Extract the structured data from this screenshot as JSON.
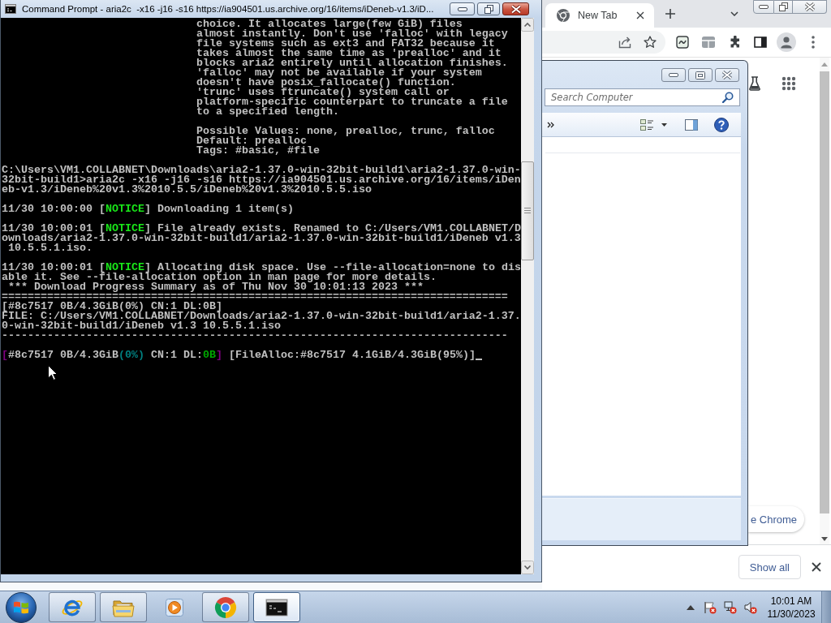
{
  "cmd_window": {
    "title": "Command Prompt - aria2c  -x16 -j16 -s16 https://ia904501.us.archive.org/16/items/iDeneb-v1.3/iD...",
    "console": {
      "blocks": [
        {
          "kind": "help",
          "lines": [
            {
              "text": "choice. It allocates large(few GiB) files"
            },
            {
              "text": "almost instantly. Don't use 'falloc' with legacy"
            },
            {
              "text": "file systems such as ext3 and FAT32 because it"
            },
            {
              "text": "takes almost the same time as 'prealloc' and it"
            },
            {
              "text": "blocks aria2 entirely until allocation finishes."
            },
            {
              "text": "'falloc' may not be available if your system"
            },
            {
              "text": "doesn't have posix_fallocate() function."
            },
            {
              "text": "'trunc' uses ftruncate() system call or"
            },
            {
              "text": "platform-specific counterpart to truncate a file"
            },
            {
              "text": "to a specified length."
            }
          ]
        },
        {
          "kind": "help",
          "lines": [
            {
              "text": "Possible Values: none, prealloc, trunc, falloc"
            },
            {
              "text": "Default: prealloc"
            },
            {
              "text": "Tags: #basic, #file"
            }
          ]
        },
        {
          "kind": "output",
          "lines": [
            {
              "text": "C:\\Users\\VM1.COLLABNET\\Downloads\\aria2-1.37.0-win-32bit-build1\\aria2-1.37.0-win-"
            },
            {
              "text": "32bit-build1>aria2c -x16 -j16 -s16 https://ia904501.us.archive.org/16/items/iDen"
            },
            {
              "text": "eb-v1.3/iDeneb%20v1.3%2010.5.5/iDeneb%20v1.3%2010.5.5.iso"
            }
          ]
        },
        {
          "kind": "output",
          "lines": [
            {
              "parts": [
                {
                  "text": "11/30 10:00:00 ["
                },
                {
                  "text": "NOTICE",
                  "color": "#19e619"
                },
                {
                  "text": "] Downloading 1 item(s)"
                }
              ]
            }
          ]
        },
        {
          "kind": "output",
          "lines": [
            {
              "parts": [
                {
                  "text": "11/30 10:00:01 ["
                },
                {
                  "text": "NOTICE",
                  "color": "#19e619"
                },
                {
                  "text": "] File already exists. Renamed to C:/Users/VM1.COLLABNET/D"
                }
              ]
            },
            {
              "text": "ownloads/aria2-1.37.0-win-32bit-build1/aria2-1.37.0-win-32bit-build1/iDeneb v1.3"
            },
            {
              "text": " 10.5.5.1.iso."
            }
          ]
        },
        {
          "kind": "output",
          "lines": [
            {
              "parts": [
                {
                  "text": "11/30 10:00:01 ["
                },
                {
                  "text": "NOTICE",
                  "color": "#19e619"
                },
                {
                  "text": "] Allocating disk space. Use --file-allocation=none to dis"
                }
              ]
            },
            {
              "text": "able it. See --file-allocation option in man page for more details."
            },
            {
              "text": " *** Download Progress Summary as of Thu Nov 30 10:01:13 2023 ***"
            },
            {
              "text": "=============================================================================="
            },
            {
              "text": "[#8c7517 0B/4.3GiB(0%) CN:1 DL:0B]"
            },
            {
              "text": "FILE: C:/Users/VM1.COLLABNET/Downloads/aria2-1.37.0-win-32bit-build1/aria2-1.37."
            },
            {
              "text": "0-win-32bit-build1/iDeneb v1.3 10.5.5.1.iso"
            },
            {
              "text": "------------------------------------------------------------------------------"
            }
          ]
        },
        {
          "kind": "output",
          "lines": [
            {
              "parts": [
                {
                  "text": "[",
                  "color": "#800080"
                },
                {
                  "text": "#8c7517 0B/4.3GiB"
                },
                {
                  "text": "(0%)",
                  "color": "#008080"
                },
                {
                  "text": " CN:1 DL:"
                },
                {
                  "text": "0B",
                  "color": "#00a800"
                },
                {
                  "text": "]",
                  "color": "#800080"
                },
                {
                  "text": " [FileAlloc:#8c7517 4.1GiB/4.3GiB(95%)]"
                }
              ]
            }
          ]
        }
      ]
    }
  },
  "chrome_window": {
    "tabs": [
      {
        "label": "New Tab",
        "selected": true
      }
    ],
    "customize_button": "e Chrome",
    "downloads_bar": {
      "show_all_button": "Show all"
    }
  },
  "explorer_window": {
    "search": {
      "placeholder": "Search Computer"
    }
  },
  "taskbar": {
    "items": [
      {
        "running": true,
        "selected": false
      },
      {
        "running": true,
        "selected": false
      },
      {
        "running": false,
        "selected": false
      },
      {
        "running": true,
        "selected": false
      },
      {
        "running": true,
        "selected": true
      }
    ],
    "clock": {
      "time": "10:01 AM",
      "date": "11/30/2023"
    }
  }
}
